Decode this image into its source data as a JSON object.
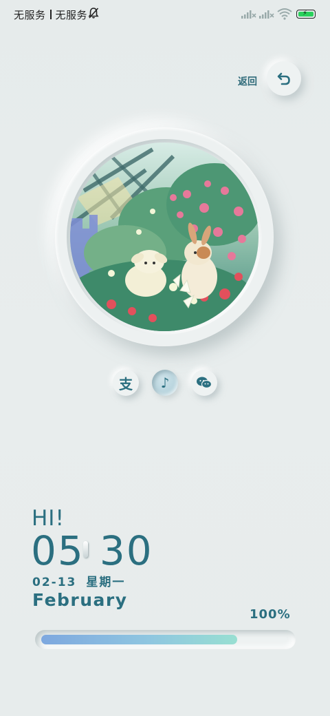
{
  "statusbar": {
    "carrier_1": "无服务",
    "carrier_2": "无服务",
    "icons": [
      "bell-muted-icon",
      "signal-no-service-icon",
      "signal-no-service-icon",
      "wifi-icon",
      "battery-charging-icon"
    ],
    "battery_level": 1.0
  },
  "header": {
    "back_label": "返回",
    "back_icon": "undo-arrow-icon"
  },
  "artwork": {
    "icon": "rabbits-in-flower-garden-painting"
  },
  "apps": [
    {
      "name": "alipay",
      "icon": "alipay-icon",
      "glyph": "支",
      "active": false
    },
    {
      "name": "tiktok",
      "icon": "tiktok-icon",
      "glyph": "♪",
      "active": true
    },
    {
      "name": "wechat",
      "icon": "wechat-icon",
      "glyph": "",
      "active": false
    }
  ],
  "clock": {
    "greeting": "HI!",
    "hours": "05",
    "minutes": "30",
    "date": "02-13",
    "weekday": "星期一",
    "month": "February"
  },
  "battery": {
    "percent_label": "100%",
    "level": 0.79
  },
  "colors": {
    "accent": "#2b6f80",
    "background": "#e7ecec",
    "bar_start": "#7ea8df",
    "bar_end": "#98dfd2"
  }
}
